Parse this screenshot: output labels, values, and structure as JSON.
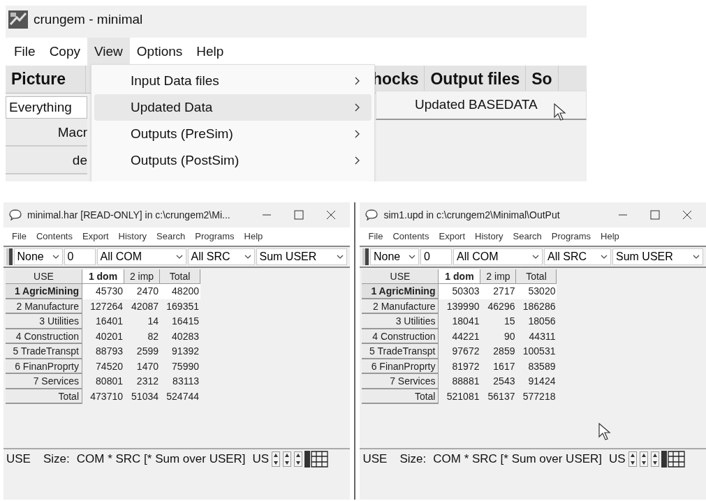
{
  "main_window": {
    "title": "crungem - minimal",
    "menu": [
      {
        "label": "File",
        "selected": false
      },
      {
        "label": "Copy",
        "selected": false
      },
      {
        "label": "View",
        "selected": true
      },
      {
        "label": "Options",
        "selected": false
      },
      {
        "label": "Help",
        "selected": false
      }
    ],
    "tabs": [
      "Picture",
      "hocks",
      "Output files",
      "So"
    ],
    "filter_field": "Everything",
    "left_rows": [
      "Macr",
      "de"
    ]
  },
  "view_menu": {
    "items": [
      {
        "label": "Input Data files",
        "selected": false,
        "submenu": true
      },
      {
        "label": "Updated Data",
        "selected": true,
        "submenu": true
      },
      {
        "label": "Outputs (PreSim)",
        "selected": false,
        "submenu": true
      },
      {
        "label": "Outputs (PostSim)",
        "selected": false,
        "submenu": true
      }
    ]
  },
  "submenu": {
    "items": [
      "Updated BASEDATA"
    ]
  },
  "viewers": [
    {
      "title": "minimal.har [READ-ONLY]  in  c:\\crungem2\\Mi...",
      "menu": [
        "File",
        "Contents",
        "Export",
        "History",
        "Search",
        "Programs",
        "Help"
      ],
      "toolbar": {
        "set": "None",
        "number": "0",
        "com": "All COM",
        "src": "All SRC",
        "user": "Sum USER"
      },
      "table": {
        "corner": "USE",
        "columns": [
          {
            "label": "1 dom",
            "selected": true
          },
          {
            "label": "2 imp",
            "selected": false
          },
          {
            "label": "Total",
            "selected": false
          }
        ],
        "rows": [
          {
            "label": "1 AgricMining",
            "selected": true,
            "cells": [
              "45730",
              "2470",
              "48200"
            ]
          },
          {
            "label": "2 Manufacture",
            "selected": false,
            "cells": [
              "127264",
              "42087",
              "169351"
            ]
          },
          {
            "label": "3 Utilities",
            "selected": false,
            "cells": [
              "16401",
              "14",
              "16415"
            ]
          },
          {
            "label": "4 Construction",
            "selected": false,
            "cells": [
              "40201",
              "82",
              "40283"
            ]
          },
          {
            "label": "5 TradeTranspt",
            "selected": false,
            "cells": [
              "88793",
              "2599",
              "91392"
            ]
          },
          {
            "label": "6 FinanProprty",
            "selected": false,
            "cells": [
              "74520",
              "1470",
              "75990"
            ]
          },
          {
            "label": "7 Services",
            "selected": false,
            "cells": [
              "80801",
              "2312",
              "83113"
            ]
          },
          {
            "label": "Total",
            "selected": false,
            "cells": [
              "473710",
              "51034",
              "524744"
            ]
          }
        ]
      },
      "status": {
        "header": "USE",
        "size_label": "Size:",
        "size": "COM * SRC [* Sum over USER]",
        "field": "US"
      },
      "cursor": false
    },
    {
      "title": "sim1.upd   in  c:\\crungem2\\Minimal\\OutPut",
      "menu": [
        "File",
        "Contents",
        "Export",
        "History",
        "Search",
        "Programs",
        "Help"
      ],
      "toolbar": {
        "set": "None",
        "number": "0",
        "com": "All COM",
        "src": "All SRC",
        "user": "Sum USER"
      },
      "table": {
        "corner": "USE",
        "columns": [
          {
            "label": "1 dom",
            "selected": true
          },
          {
            "label": "2 imp",
            "selected": false
          },
          {
            "label": "Total",
            "selected": false
          }
        ],
        "rows": [
          {
            "label": "1 AgricMining",
            "selected": true,
            "cells": [
              "50303",
              "2717",
              "53020"
            ]
          },
          {
            "label": "2 Manufacture",
            "selected": false,
            "cells": [
              "139990",
              "46296",
              "186286"
            ]
          },
          {
            "label": "3 Utilities",
            "selected": false,
            "cells": [
              "18041",
              "15",
              "18056"
            ]
          },
          {
            "label": "4 Construction",
            "selected": false,
            "cells": [
              "44221",
              "90",
              "44311"
            ]
          },
          {
            "label": "5 TradeTranspt",
            "selected": false,
            "cells": [
              "97672",
              "2859",
              "100531"
            ]
          },
          {
            "label": "6 FinanProprty",
            "selected": false,
            "cells": [
              "81972",
              "1617",
              "83589"
            ]
          },
          {
            "label": "7 Services",
            "selected": false,
            "cells": [
              "88881",
              "2543",
              "91424"
            ]
          },
          {
            "label": "Total",
            "selected": false,
            "cells": [
              "521081",
              "56137",
              "577218"
            ]
          }
        ]
      },
      "status": {
        "header": "USE",
        "size_label": "Size:",
        "size": "COM * SRC [* Sum over USER]",
        "field": "US"
      },
      "cursor": true
    }
  ]
}
